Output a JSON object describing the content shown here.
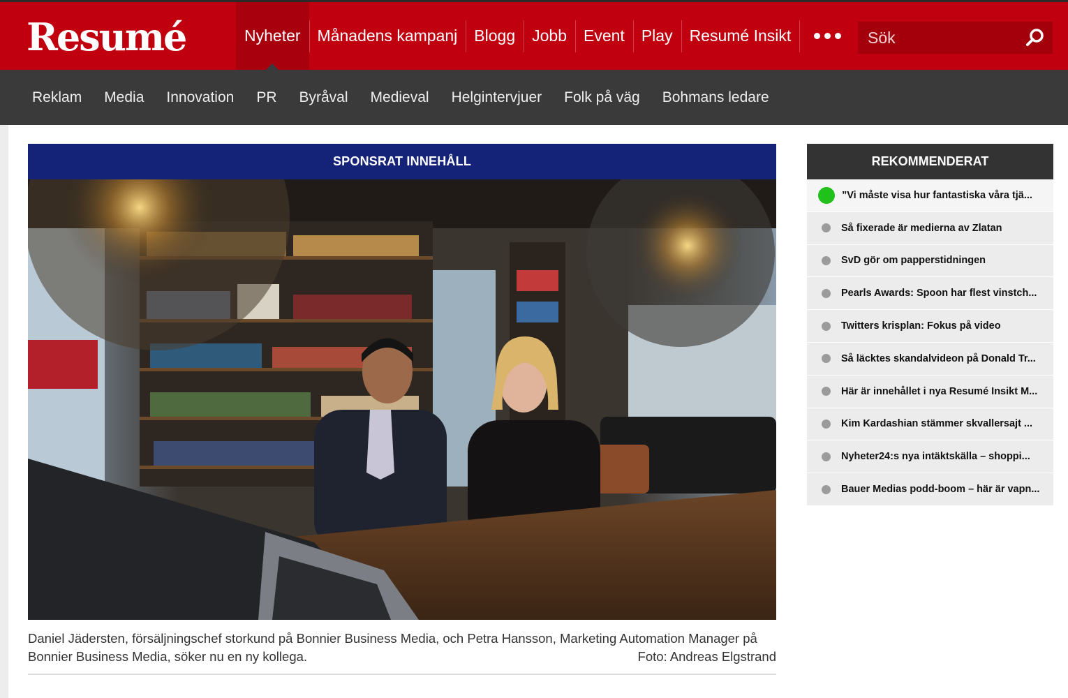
{
  "brand": {
    "logo_text": "Resumé",
    "primary_color": "#c0000f",
    "nav_dark": "#3a3a3a",
    "sponsor_color": "#142278"
  },
  "topnav": {
    "items": [
      "Nyheter",
      "Månadens kampanj",
      "Blogg",
      "Jobb",
      "Event",
      "Play",
      "Resumé Insikt"
    ],
    "active": "Nyheter",
    "more_icon": "more-dots-icon"
  },
  "search": {
    "placeholder": "Sök",
    "icon": "search-icon"
  },
  "subnav": {
    "items": [
      "Reklam",
      "Media",
      "Innovation",
      "PR",
      "Byråval",
      "Medieval",
      "Helgintervjuer",
      "Folk på väg",
      "Bohmans ledare"
    ]
  },
  "article": {
    "sponsor_label": "SPONSRAT INNEHÅLL",
    "caption": "Daniel Jädersten, försäljningschef storkund på Bonnier Business Media, och Petra Hansson, Marketing Automation Manager på Bonnier Business Media, söker nu en ny kollega.",
    "photo_credit": "Foto: Andreas Elgstrand"
  },
  "sidebar": {
    "title": "REKOMMENDERAT",
    "items": [
      "”Vi måste visa hur fantastiska våra tjä...",
      "Så fixerade är medierna av Zlatan",
      "SvD gör om papperstidningen",
      "Pearls Awards: Spoon har flest vinstch...",
      "Twitters krisplan: Fokus på video",
      "Så läcktes skandalvideon på Donald Tr...",
      "Här är innehållet i nya Resumé Insikt M...",
      "Kim Kardashian stämmer skvallersajt ...",
      "Nyheter24:s nya intäktskälla – shoppi...",
      "Bauer Medias podd-boom – här är vapn..."
    ],
    "live_indicator_color": "#1fc11a"
  }
}
